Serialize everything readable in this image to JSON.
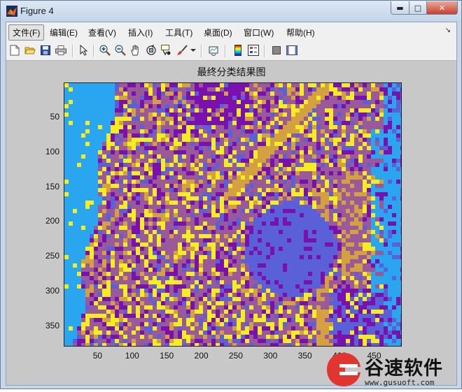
{
  "window": {
    "title": "Figure 4"
  },
  "menu": [
    {
      "label": "文件(F)"
    },
    {
      "label": "编辑(E)"
    },
    {
      "label": "查看(V)"
    },
    {
      "label": "插入(I)"
    },
    {
      "label": "工具(T)"
    },
    {
      "label": "桌面(D)"
    },
    {
      "label": "窗口(W)"
    },
    {
      "label": "帮助(H)"
    }
  ],
  "toolbar": [
    "new-figure-icon",
    "open-file-icon",
    "save-icon",
    "print-icon",
    "edit-plot-arrow-icon",
    "zoom-in-icon",
    "zoom-out-icon",
    "pan-hand-icon",
    "rotate-3d-icon",
    "data-cursor-icon",
    "brush-icon",
    "link-plot-icon",
    "colorbar-icon",
    "legend-icon",
    "hide-plot-tools-icon",
    "show-plot-tools-icon"
  ],
  "chart_data": {
    "type": "heatmap",
    "title": "最终分类结果图",
    "xlabel": "",
    "ylabel": "",
    "xlim": [
      1,
      490
    ],
    "ylim": [
      1,
      380
    ],
    "x_ticks": [
      "50",
      "100",
      "150",
      "200",
      "250",
      "300",
      "350",
      "400",
      "450"
    ],
    "y_ticks": [
      "50",
      "100",
      "150",
      "200",
      "250",
      "300",
      "350"
    ],
    "class_colors": [
      "#2aa6f0",
      "#9a5a9a",
      "#7a10b0",
      "#f5ee1e",
      "#d4a040",
      "#5a60d8"
    ]
  },
  "watermark": {
    "text": "谷速软件",
    "url": "www.gusuoft.com"
  }
}
